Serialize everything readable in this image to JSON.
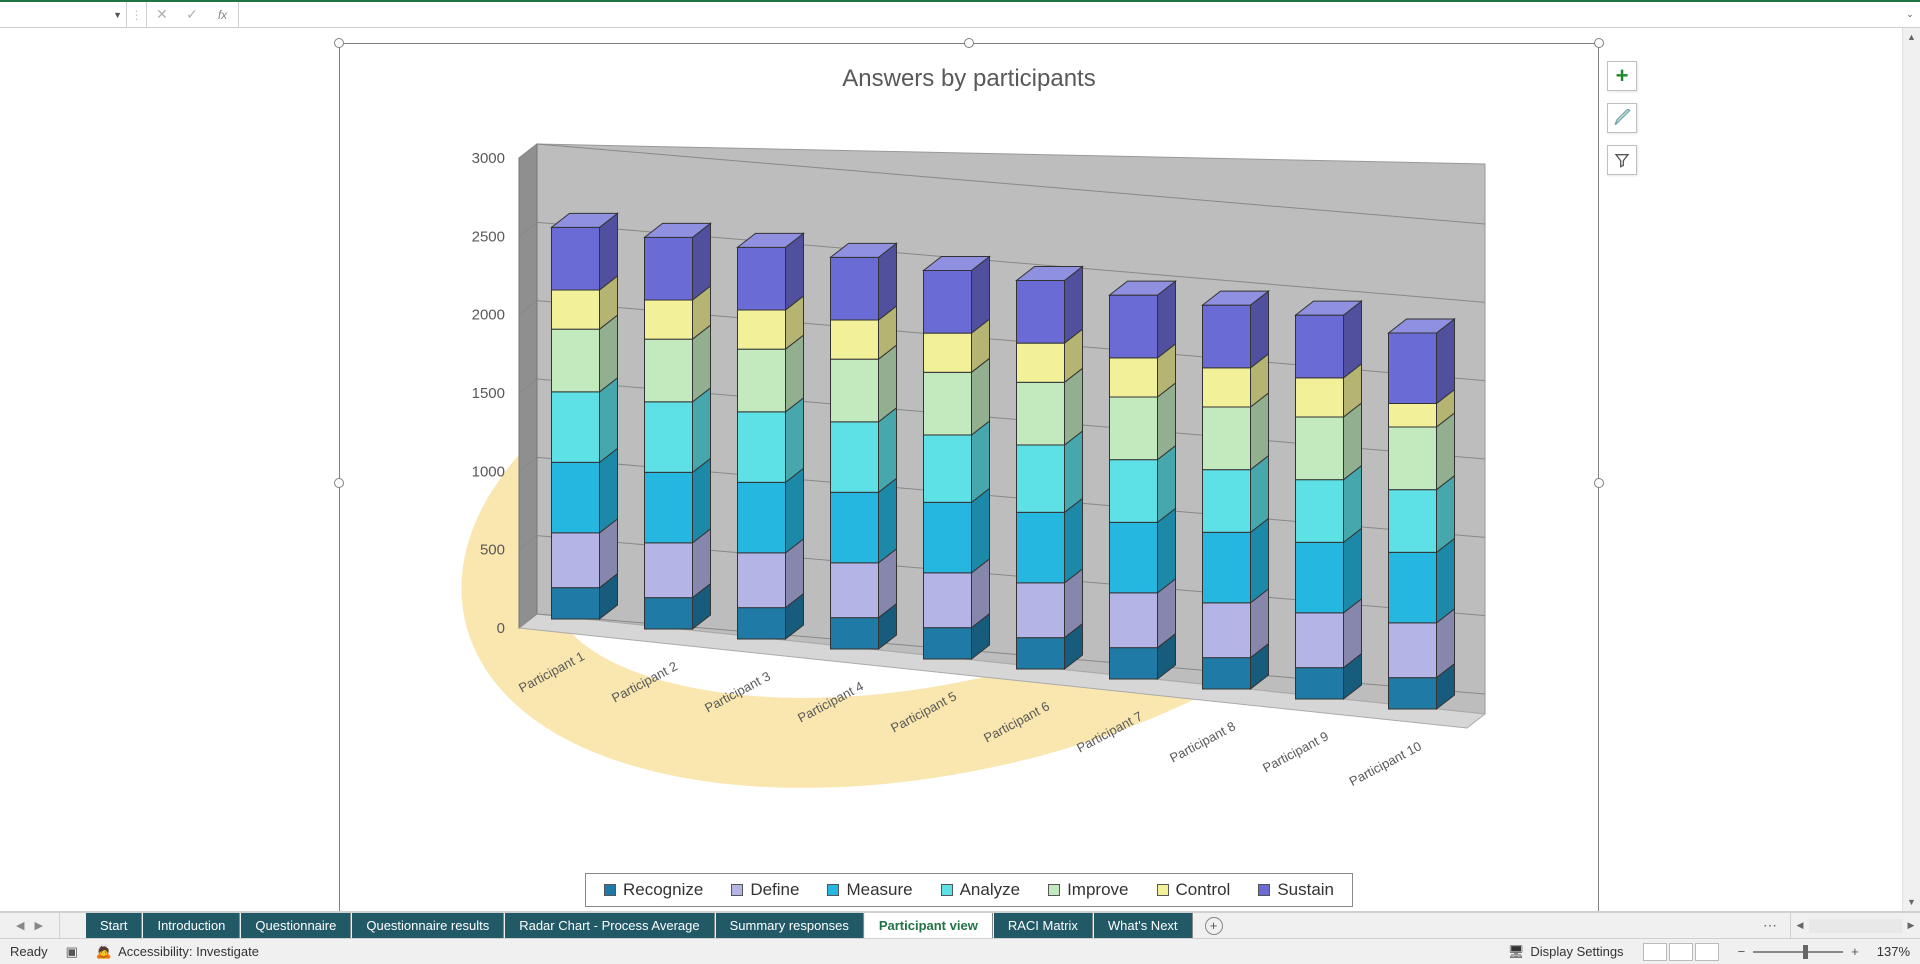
{
  "chart_data": {
    "type": "bar",
    "stacked": true,
    "title": "Answers by participants",
    "ylim": [
      0,
      3000
    ],
    "yticks": [
      0,
      500,
      1000,
      1500,
      2000,
      2500,
      3000
    ],
    "categories": [
      "Participant 1",
      "Participant 2",
      "Participant 3",
      "Participant 4",
      "Participant 5",
      "Participant 6",
      "Participant 7",
      "Participant 8",
      "Participant 9",
      "Participant 10"
    ],
    "series": [
      {
        "name": "Recognize",
        "color": "#1f7ba6",
        "values": [
          200,
          200,
          200,
          200,
          200,
          200,
          200,
          200,
          200,
          200
        ]
      },
      {
        "name": "Define",
        "color": "#b4b4e6",
        "values": [
          350,
          350,
          350,
          350,
          350,
          350,
          350,
          350,
          350,
          350
        ]
      },
      {
        "name": "Measure",
        "color": "#26b7e0",
        "values": [
          450,
          450,
          450,
          450,
          450,
          450,
          450,
          450,
          450,
          450
        ]
      },
      {
        "name": "Analyze",
        "color": "#5de0e6",
        "values": [
          450,
          450,
          450,
          450,
          430,
          430,
          400,
          400,
          400,
          400
        ]
      },
      {
        "name": "Improve",
        "color": "#c3eabe",
        "values": [
          400,
          400,
          400,
          400,
          400,
          400,
          400,
          400,
          400,
          400
        ]
      },
      {
        "name": "Control",
        "color": "#f2f099",
        "values": [
          250,
          250,
          250,
          250,
          250,
          250,
          250,
          250,
          250,
          150
        ]
      },
      {
        "name": "Sustain",
        "color": "#6a6bd4",
        "values": [
          400,
          400,
          400,
          400,
          400,
          400,
          400,
          400,
          400,
          450
        ]
      }
    ],
    "legend_position": "bottom"
  },
  "formula_bar": {
    "name_box": "",
    "fx_label": "fx",
    "value": ""
  },
  "tabs": [
    {
      "label": "Start"
    },
    {
      "label": "Introduction"
    },
    {
      "label": "Questionnaire"
    },
    {
      "label": "Questionnaire results"
    },
    {
      "label": "Radar Chart - Process Average"
    },
    {
      "label": "Summary responses"
    },
    {
      "label": "Participant view",
      "active": true
    },
    {
      "label": "RACI Matrix"
    },
    {
      "label": "What's Next"
    }
  ],
  "status_bar": {
    "ready": "Ready",
    "accessibility": "Accessibility: Investigate",
    "display_settings": "Display Settings",
    "zoom_pct": "137%"
  },
  "side_buttons": {
    "add": "+"
  }
}
